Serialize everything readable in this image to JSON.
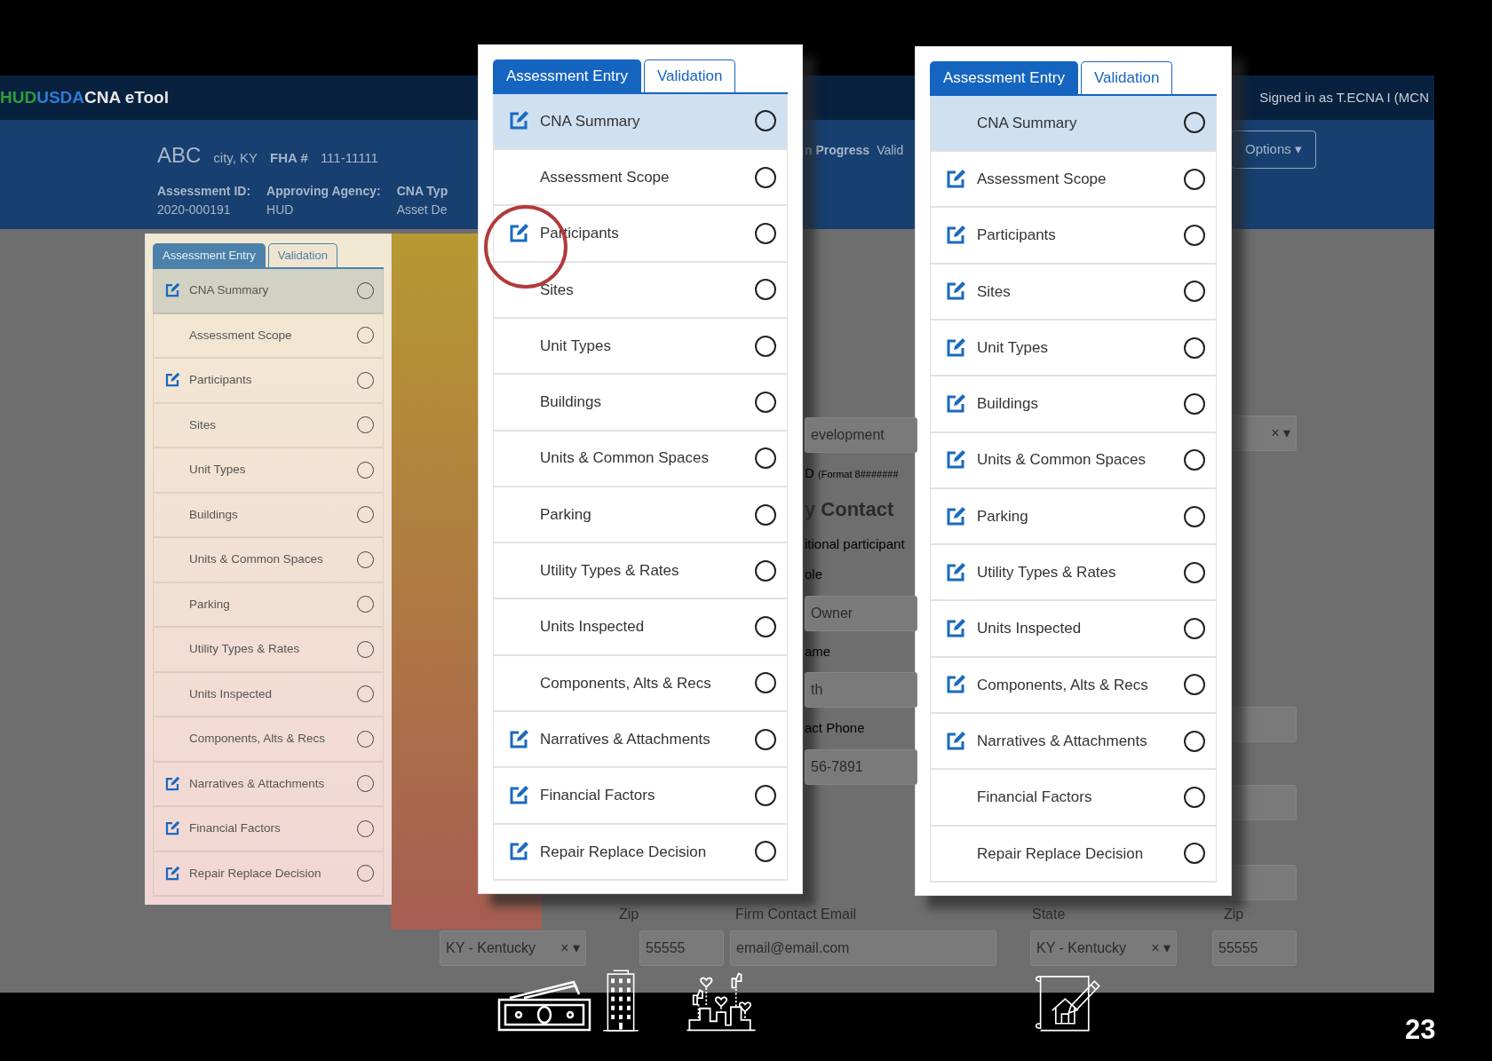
{
  "app": {
    "brand": [
      "HUD",
      "USDA",
      "CNA eTool"
    ],
    "signed_in": "Signed in as T.ECNA I (MCN",
    "header": {
      "property": "ABC",
      "location": "city, KY",
      "fha_label": "FHA #",
      "fha_number": "111-11111",
      "status": "n Progress",
      "tab_fragment": "Valid",
      "options_button": "Options",
      "options_caret": "▾"
    },
    "details": [
      {
        "label": "Assessment ID:",
        "value": "2020-000191"
      },
      {
        "label": "Approving Agency:",
        "value": "HUD"
      },
      {
        "label": "CNA Typ",
        "value": "Asset De"
      }
    ],
    "form_fragments": [
      {
        "kind": "field",
        "text": "evelopment"
      },
      {
        "kind": "hint",
        "text": "D",
        "note": "(Format 8#######"
      },
      {
        "kind": "heading",
        "text": "y Contact"
      },
      {
        "kind": "label",
        "text": "itional participant"
      },
      {
        "kind": "label",
        "text": "ole"
      },
      {
        "kind": "field",
        "text": "Owner"
      },
      {
        "kind": "label",
        "text": "ame"
      },
      {
        "kind": "field",
        "text": "th"
      },
      {
        "kind": "label",
        "text": "act Phone"
      },
      {
        "kind": "field",
        "text": "56-7891"
      }
    ],
    "right_fields": [
      {
        "kind": "select",
        "clear": "×",
        "caret": "▾"
      },
      {
        "kind": "blank"
      },
      {
        "kind": "blank"
      },
      {
        "kind": "blank"
      }
    ],
    "bottom_labels": [
      "Zip",
      "Firm Contact Email",
      "State",
      "Zip"
    ],
    "bottom_fields": [
      {
        "kind": "select",
        "value": "KY - Kentucky",
        "clear": "×",
        "caret": "▾"
      },
      {
        "kind": "text",
        "value": "55555"
      },
      {
        "kind": "text",
        "value": "email@email.com"
      },
      {
        "kind": "select",
        "value": "KY - Kentucky",
        "clear": "×",
        "caret": "▾"
      },
      {
        "kind": "text",
        "value": "55555"
      }
    ]
  },
  "panels": [
    {
      "tinted": true,
      "tabs": [
        {
          "label": "Assessment Entry",
          "selected": true
        },
        {
          "label": "Validation",
          "selected": false
        }
      ],
      "items": [
        {
          "label": "CNA Summary",
          "selected": true,
          "edit_icon": true,
          "checked": false
        },
        {
          "label": "Assessment Scope",
          "selected": false,
          "edit_icon": false,
          "checked": false
        },
        {
          "label": "Participants",
          "selected": false,
          "edit_icon": true,
          "checked": false
        },
        {
          "label": "Sites",
          "selected": false,
          "edit_icon": false,
          "checked": false
        },
        {
          "label": "Unit Types",
          "selected": false,
          "edit_icon": false,
          "checked": false
        },
        {
          "label": "Buildings",
          "selected": false,
          "edit_icon": false,
          "checked": false
        },
        {
          "label": "Units & Common Spaces",
          "selected": false,
          "edit_icon": false,
          "checked": false
        },
        {
          "label": "Parking",
          "selected": false,
          "edit_icon": false,
          "checked": false
        },
        {
          "label": "Utility Types & Rates",
          "selected": false,
          "edit_icon": false,
          "checked": false
        },
        {
          "label": "Units Inspected",
          "selected": false,
          "edit_icon": false,
          "checked": false
        },
        {
          "label": "Components, Alts & Recs",
          "selected": false,
          "edit_icon": false,
          "checked": false
        },
        {
          "label": "Narratives & Attachments",
          "selected": false,
          "edit_icon": true,
          "checked": false
        },
        {
          "label": "Financial Factors",
          "selected": false,
          "edit_icon": true,
          "checked": false
        },
        {
          "label": "Repair Replace Decision",
          "selected": false,
          "edit_icon": true,
          "checked": false
        }
      ]
    },
    {
      "tinted": false,
      "tabs": [
        {
          "label": "Assessment Entry",
          "selected": true
        },
        {
          "label": "Validation",
          "selected": false
        }
      ],
      "items": [
        {
          "label": "CNA Summary",
          "selected": true,
          "edit_icon": true,
          "checked": false
        },
        {
          "label": "Assessment Scope",
          "selected": false,
          "edit_icon": false,
          "checked": false
        },
        {
          "label": "Participants",
          "selected": false,
          "edit_icon": true,
          "checked": false
        },
        {
          "label": "Sites",
          "selected": false,
          "edit_icon": false,
          "checked": false
        },
        {
          "label": "Unit Types",
          "selected": false,
          "edit_icon": false,
          "checked": false
        },
        {
          "label": "Buildings",
          "selected": false,
          "edit_icon": false,
          "checked": false
        },
        {
          "label": "Units & Common Spaces",
          "selected": false,
          "edit_icon": false,
          "checked": false
        },
        {
          "label": "Parking",
          "selected": false,
          "edit_icon": false,
          "checked": false
        },
        {
          "label": "Utility Types & Rates",
          "selected": false,
          "edit_icon": false,
          "checked": false
        },
        {
          "label": "Units Inspected",
          "selected": false,
          "edit_icon": false,
          "checked": false
        },
        {
          "label": "Components, Alts & Recs",
          "selected": false,
          "edit_icon": false,
          "checked": false
        },
        {
          "label": "Narratives & Attachments",
          "selected": false,
          "edit_icon": true,
          "checked": false
        },
        {
          "label": "Financial Factors",
          "selected": false,
          "edit_icon": true,
          "checked": false
        },
        {
          "label": "Repair Replace Decision",
          "selected": false,
          "edit_icon": true,
          "checked": false
        }
      ]
    },
    {
      "tinted": false,
      "tabs": [
        {
          "label": "Assessment Entry",
          "selected": true
        },
        {
          "label": "Validation",
          "selected": false
        }
      ],
      "items": [
        {
          "label": "CNA Summary",
          "selected": true,
          "edit_icon": false,
          "checked": false
        },
        {
          "label": "Assessment Scope",
          "selected": false,
          "edit_icon": true,
          "checked": false
        },
        {
          "label": "Participants",
          "selected": false,
          "edit_icon": true,
          "checked": false
        },
        {
          "label": "Sites",
          "selected": false,
          "edit_icon": true,
          "checked": false
        },
        {
          "label": "Unit Types",
          "selected": false,
          "edit_icon": true,
          "checked": false
        },
        {
          "label": "Buildings",
          "selected": false,
          "edit_icon": true,
          "checked": false
        },
        {
          "label": "Units & Common Spaces",
          "selected": false,
          "edit_icon": true,
          "checked": false
        },
        {
          "label": "Parking",
          "selected": false,
          "edit_icon": true,
          "checked": false
        },
        {
          "label": "Utility Types & Rates",
          "selected": false,
          "edit_icon": true,
          "checked": false
        },
        {
          "label": "Units Inspected",
          "selected": false,
          "edit_icon": true,
          "checked": false
        },
        {
          "label": "Components, Alts & Recs",
          "selected": false,
          "edit_icon": true,
          "checked": false
        },
        {
          "label": "Narratives & Attachments",
          "selected": false,
          "edit_icon": true,
          "checked": false
        },
        {
          "label": "Financial Factors",
          "selected": false,
          "edit_icon": false,
          "checked": false
        },
        {
          "label": "Repair Replace Decision",
          "selected": false,
          "edit_icon": false,
          "checked": false
        }
      ]
    }
  ],
  "slide_number": "23"
}
